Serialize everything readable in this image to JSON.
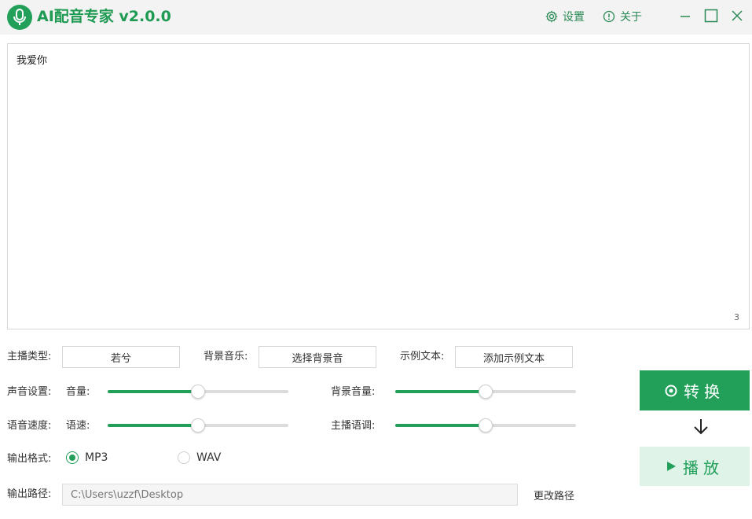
{
  "app": {
    "title": "AI配音专家 v2.0.0",
    "settings_label": "设置",
    "about_label": "关于",
    "accent_color": "#22a05a"
  },
  "editor": {
    "text": "我爱你",
    "char_count": "3"
  },
  "controls": {
    "anchor_type_label": "主播类型:",
    "anchor_type_value": "若兮",
    "bg_music_label": "背景音乐:",
    "bg_music_button": "选择背景音",
    "sample_text_label": "示例文本:",
    "sample_text_button": "添加示例文本",
    "voice_settings_label": "声音设置:",
    "volume_label": "音量:",
    "volume_value": 0.5,
    "bg_volume_label": "背景音量:",
    "bg_volume_value": 0.5,
    "speed_section_label": "语音速度:",
    "speed_label": "语速:",
    "speed_value": 0.5,
    "pitch_label": "主播语调:",
    "pitch_value": 0.5,
    "format_label": "输出格式:",
    "format_options": [
      "MP3",
      "WAV"
    ],
    "format_selected": "MP3",
    "path_label": "输出路径:",
    "path_placeholder": "C:\\Users\\uzzf\\Desktop",
    "change_path": "更改路径"
  },
  "actions": {
    "convert_label": "转换",
    "play_label": "播放"
  }
}
